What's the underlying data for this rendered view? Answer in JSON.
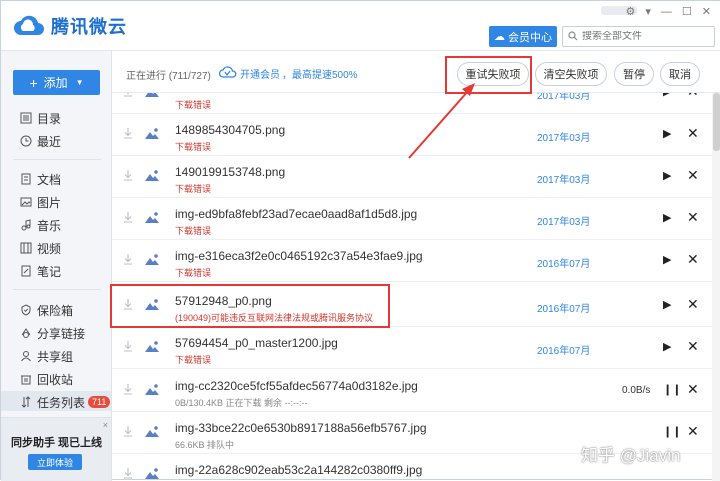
{
  "app": {
    "title": "腾讯微云"
  },
  "header": {
    "vip_center": "会员中心",
    "search_placeholder": "搜索全部文件"
  },
  "sidebar": {
    "add_label": "添加",
    "items": [
      {
        "label": "目录",
        "icon": "list-icon"
      },
      {
        "label": "最近",
        "icon": "clock-icon"
      },
      {
        "label": "文档",
        "icon": "document-icon"
      },
      {
        "label": "图片",
        "icon": "image-icon"
      },
      {
        "label": "音乐",
        "icon": "music-icon"
      },
      {
        "label": "视频",
        "icon": "video-icon"
      },
      {
        "label": "笔记",
        "icon": "note-icon"
      },
      {
        "label": "保险箱",
        "icon": "shield-icon"
      },
      {
        "label": "分享链接",
        "icon": "share-icon"
      },
      {
        "label": "共享组",
        "icon": "group-icon"
      },
      {
        "label": "回收站",
        "icon": "recycle-icon"
      },
      {
        "label": "任务列表",
        "icon": "sort-icon",
        "badge": "711"
      }
    ],
    "promo": {
      "title": "同步助手 现已上线",
      "button": "立即体验",
      "close": "×"
    }
  },
  "toolbar": {
    "progress": "正在进行 (711/727)",
    "vip_link": "开通会员",
    "vip_text": "，最高提速500%",
    "retry_failed": "重试失败项",
    "clear_failed": "清空失败项",
    "pause": "暂停",
    "cancel": "取消"
  },
  "tasks": [
    {
      "name": "",
      "status": "下载错误",
      "status_type": "error",
      "date": "2017年03月",
      "speed": ""
    },
    {
      "name": "1489854304705.png",
      "status": "下载错误",
      "status_type": "error",
      "date": "2017年03月",
      "speed": ""
    },
    {
      "name": "1490199153748.png",
      "status": "下载错误",
      "status_type": "error",
      "date": "2017年03月",
      "speed": ""
    },
    {
      "name": "img-ed9bfa8febf23ad7ecae0aad8af1d5d8.jpg",
      "status": "下载错误",
      "status_type": "error",
      "date": "2017年03月",
      "speed": ""
    },
    {
      "name": "img-e316eca3f2e0c0465192c37a54e3fae9.jpg",
      "status": "下载错误",
      "status_type": "error",
      "date": "2016年07月",
      "speed": ""
    },
    {
      "name": "57912948_p0.png",
      "status": "(190049)可能违反互联网法律法规或腾讯服务协议",
      "status_type": "error",
      "date": "2016年07月",
      "speed": ""
    },
    {
      "name": "57694454_p0_master1200.jpg",
      "status": "下载错误",
      "status_type": "error",
      "date": "2016年07月",
      "speed": ""
    },
    {
      "name": "img-cc2320ce5fcf55afdec56774a0d3182e.jpg",
      "status": "0B/130.4KB    正在下载    剩余 --:--:--",
      "status_type": "ok",
      "date": "",
      "speed": "0.0B/s"
    },
    {
      "name": "img-33bce22c0e6530b8917188a56efb5767.jpg",
      "status": "66.6KB    排队中",
      "status_type": "ok",
      "date": "",
      "speed": ""
    },
    {
      "name": "img-22a628c902eab53c2a144282c0380ff9.jpg",
      "status": "",
      "status_type": "ok",
      "date": "",
      "speed": ""
    }
  ],
  "watermark": "知乎 @Jiavin",
  "colors": {
    "accent": "#2f86e4",
    "error": "#d4362b",
    "highlight": "#e53935"
  }
}
